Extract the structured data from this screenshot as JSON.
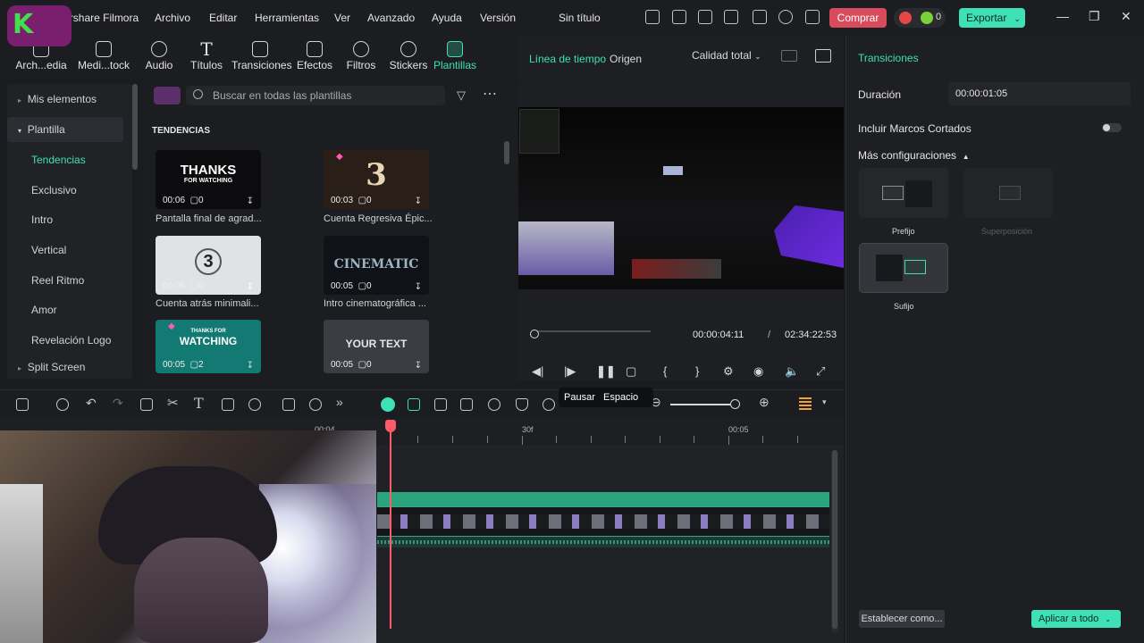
{
  "app": {
    "name": "Wondershare Filmora",
    "project_title": "Sin título"
  },
  "menu": [
    "Archivo",
    "Editar",
    "Herramientas",
    "Ver",
    "Avanzado",
    "Ayuda",
    "Versión"
  ],
  "header": {
    "buy_label": "Comprar",
    "coins": "0",
    "export_label": "Exportar"
  },
  "library_tabs": [
    {
      "label": "Arch...edia",
      "icon": "folder-media-icon"
    },
    {
      "label": "Medi...tock",
      "icon": "stock-media-icon"
    },
    {
      "label": "Audio",
      "icon": "music-note-icon"
    },
    {
      "label": "Títulos",
      "icon": "text-icon"
    },
    {
      "label": "Transiciones",
      "icon": "transition-icon"
    },
    {
      "label": "Efectos",
      "icon": "effects-icon"
    },
    {
      "label": "Filtros",
      "icon": "filter-icon"
    },
    {
      "label": "Stickers",
      "icon": "sticker-icon"
    },
    {
      "label": "Plantillas",
      "icon": "template-icon"
    }
  ],
  "sidebar": {
    "items": [
      {
        "label": "Mis elementos"
      },
      {
        "label": "Plantilla"
      },
      {
        "label": "Tendencias"
      },
      {
        "label": "Exclusivo"
      },
      {
        "label": "Intro"
      },
      {
        "label": "Vertical"
      },
      {
        "label": "Reel Ritmo"
      },
      {
        "label": "Amor"
      },
      {
        "label": "Revelación Logo"
      },
      {
        "label": "Split Screen"
      }
    ]
  },
  "templates": {
    "search_placeholder": "Buscar en todas las plantillas",
    "section_title": "TENDENCIAS",
    "cards": [
      {
        "thumb_text": "THANKS",
        "thumb_sub": "FOR WATCHING",
        "duration": "00:06",
        "layers": "0",
        "label": "Pantalla final de agrad..."
      },
      {
        "thumb_text": "3",
        "thumb_sub": "",
        "duration": "00:03",
        "layers": "0",
        "label": "Cuenta Regresiva Épic..."
      },
      {
        "thumb_text": "3",
        "thumb_sub": "",
        "duration": "00:06",
        "layers": "0",
        "label": "Cuenta atrás minimali..."
      },
      {
        "thumb_text": "CINEMATIC",
        "thumb_sub": "",
        "duration": "00:05",
        "layers": "0",
        "label": "Intro cinematográfica ..."
      },
      {
        "thumb_text": "WATCHING",
        "thumb_sub": "THANKS FOR",
        "duration": "00:05",
        "layers": "2",
        "label": ""
      },
      {
        "thumb_text": "YOUR TEXT",
        "thumb_sub": "",
        "duration": "00:05",
        "layers": "0",
        "label": ""
      }
    ]
  },
  "preview": {
    "tab_timeline": "Línea de tiempo",
    "tab_source": "Origen",
    "quality": "Calidad total",
    "current_time": "00:00:04:11",
    "separator": "/",
    "total_time": "02:34:22:53",
    "progress": 0.0
  },
  "tooltip": {
    "action": "Pausar",
    "shortcut": "Espacio"
  },
  "right_panel": {
    "title": "Transiciones",
    "duration_label": "Duración",
    "duration_value": "00:00:01:05",
    "short_frames_label": "Incluir Marcos Cortados",
    "more_settings": "Más configuraciones",
    "modes": [
      "Prefijo",
      "Superposición",
      "Sufijo"
    ],
    "set_as_label": "Establecer como...",
    "apply_all_label": "Aplicar a todo"
  },
  "timeline": {
    "ruler_labels": [
      "00:04",
      "30f",
      "00:05"
    ]
  },
  "colors": {
    "accent": "#3ee0b6",
    "buy": "#d84b5c",
    "playhead": "#ff5a6a",
    "track": "#2aa57b"
  }
}
